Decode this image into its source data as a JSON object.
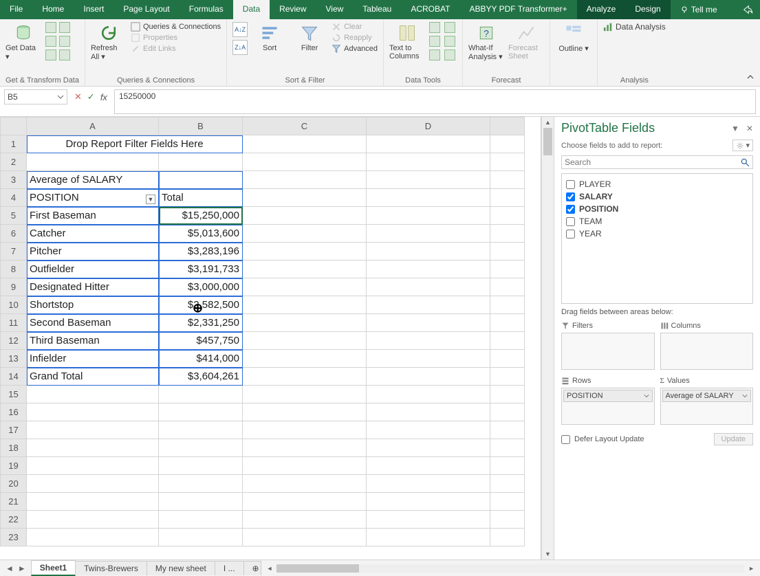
{
  "tabs": {
    "file": "File",
    "home": "Home",
    "insert": "Insert",
    "pagelayout": "Page Layout",
    "formulas": "Formulas",
    "data": "Data",
    "review": "Review",
    "view": "View",
    "tableau": "Tableau",
    "acrobat": "ACROBAT",
    "abbyy": "ABBYY PDF Transformer+",
    "analyze": "Analyze",
    "design": "Design",
    "tellme": "Tell me"
  },
  "ribbon": {
    "getdata": "Get Data",
    "refreshall": "Refresh All",
    "queriesconn": "Queries & Connections",
    "properties": "Properties",
    "editlinks": "Edit Links",
    "sort": "Sort",
    "filter": "Filter",
    "clear": "Clear",
    "reapply": "Reapply",
    "advanced": "Advanced",
    "tcolumns": "Text to Columns",
    "whatif": "What-If Analysis",
    "forecastsheet": "Forecast Sheet",
    "outline": "Outline",
    "dataanalysis": "Data Analysis",
    "g_get": "Get & Transform Data",
    "g_qc": "Queries & Connections",
    "g_sf": "Sort & Filter",
    "g_dt": "Data Tools",
    "g_fc": "Forecast",
    "g_an": "Analysis"
  },
  "namebox": "B5",
  "formula": "15250000",
  "cols": {
    "A": "A",
    "B": "B",
    "C": "C",
    "D": "D"
  },
  "rows": {
    "r1": "Drop Report Filter Fields Here",
    "r3": "Average of SALARY",
    "r4a": "POSITION",
    "r4b": "Total",
    "pt": [
      {
        "pos": "First Baseman",
        "val": "$15,250,000"
      },
      {
        "pos": "Catcher",
        "val": "$5,013,600"
      },
      {
        "pos": "Pitcher",
        "val": "$3,283,196"
      },
      {
        "pos": "Outfielder",
        "val": "$3,191,733"
      },
      {
        "pos": "Designated Hitter",
        "val": "$3,000,000"
      },
      {
        "pos": "Shortstop",
        "val": "$2,582,500"
      },
      {
        "pos": "Second Baseman",
        "val": "$2,331,250"
      },
      {
        "pos": "Third Baseman",
        "val": "$457,750"
      },
      {
        "pos": "Infielder",
        "val": "$414,000"
      }
    ],
    "gt_label": "Grand Total",
    "gt_val": "$3,604,261"
  },
  "pane": {
    "title": "PivotTable Fields",
    "choose": "Choose fields to add to report:",
    "search_ph": "Search",
    "fields": [
      {
        "name": "PLAYER",
        "checked": false,
        "bold": false
      },
      {
        "name": "SALARY",
        "checked": true,
        "bold": true
      },
      {
        "name": "POSITION",
        "checked": true,
        "bold": true
      },
      {
        "name": "TEAM",
        "checked": false,
        "bold": false
      },
      {
        "name": "YEAR",
        "checked": false,
        "bold": false
      }
    ],
    "drag": "Drag fields between areas below:",
    "filters": "Filters",
    "columns": "Columns",
    "rowsa": "Rows",
    "values": "Values",
    "rows_tag": "POSITION",
    "values_tag": "Average of SALARY",
    "defer": "Defer Layout Update",
    "update": "Update"
  },
  "sheets": {
    "s1": "Sheet1",
    "s2": "Twins-Brewers",
    "s3": "My new sheet",
    "s4": "I ..."
  }
}
